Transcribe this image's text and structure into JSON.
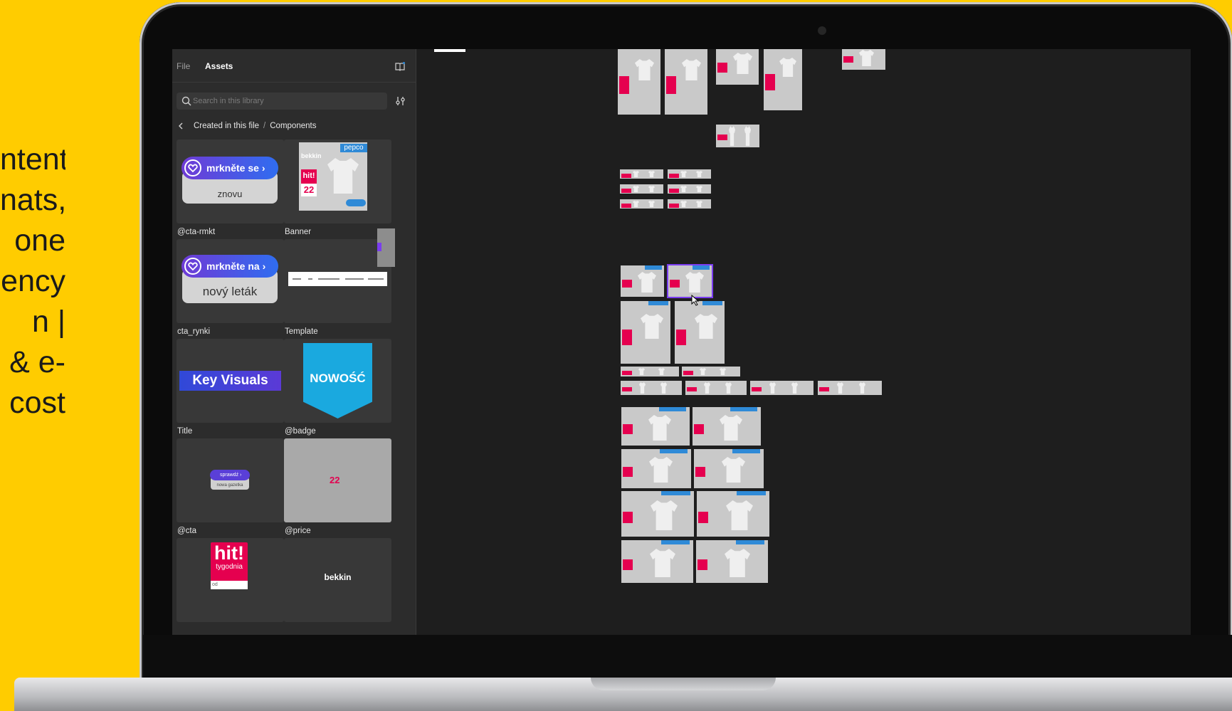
{
  "side_text": [
    "ntent",
    "nats,",
    "one",
    "ency",
    "n  |",
    "& e-",
    "cost"
  ],
  "panel": {
    "tabs": [
      {
        "label": "File",
        "active": false
      },
      {
        "label": "Assets",
        "active": true
      }
    ],
    "library_icon": "library-book-icon",
    "search": {
      "placeholder": "Search in this library",
      "value": ""
    },
    "filter_icon": "sliders-filter-icon",
    "breadcrumb": {
      "back_icon": "chevron-left-icon",
      "part1": "Created in this file",
      "separator": "/",
      "part2": "Components"
    }
  },
  "components": [
    {
      "label": "@cta-rmkt",
      "cta_text": "mrkněte se ›",
      "sub_text": "znovu"
    },
    {
      "label": "Banner",
      "brand": "bekkin",
      "pepco": "pepco",
      "hit": "hit!",
      "price": "22"
    },
    {
      "label": "cta_rynki",
      "cta_text": "mrkněte na ›",
      "sub_text": "nový leták"
    },
    {
      "label": "Template"
    },
    {
      "label": "Title",
      "title_text": "Key Visuals"
    },
    {
      "label": "@badge",
      "badge_text": "NOWOŚĆ"
    },
    {
      "label": "@cta",
      "cta_text": "sprawdź ›",
      "sub_text": "nowa gazetka"
    },
    {
      "label": "@price",
      "price_text": "22"
    },
    {
      "label": "",
      "hit_text": "hit!",
      "hit_sub": "tygodnia",
      "hit_small": "od"
    },
    {
      "label": "",
      "brand_text": "bekkin"
    }
  ],
  "colors": {
    "background": "#ffcc00",
    "panel": "#2c2c2c",
    "canvas": "#1e1e1e",
    "accent_purple": "#7a3cf0",
    "brand_pink": "#e5004f",
    "brand_blue": "#2f8ad7"
  }
}
